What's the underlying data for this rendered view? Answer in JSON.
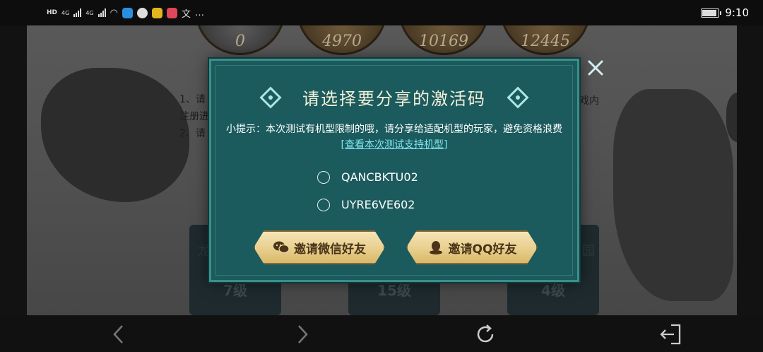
{
  "status_bar": {
    "time": "9:10",
    "network_1": "HD",
    "network_2": "HD",
    "signal_label_1": "4G",
    "signal_label_2": "4G",
    "more": "…",
    "battery_level": 0.9
  },
  "background": {
    "scores": [
      "0",
      "4970",
      "10169",
      "12445"
    ],
    "text_line_1": "1、请",
    "text_line_2": "注册进",
    "text_line_3": "2、请",
    "text_right": "戏内",
    "cards": [
      {
        "name": "龙",
        "level": "7级"
      },
      {
        "name": "",
        "level": "15级"
      },
      {
        "name": "园",
        "level": "4级"
      }
    ]
  },
  "modal": {
    "title": "请选择要分享的激活码",
    "tip_text": "小提示：本次测试有机型限制的哦，请分享给适配机型的玩家，避免资格浪费",
    "tip_link": "[查看本次测试支持机型]",
    "codes": [
      "QANCBKTU02",
      "UYRE6VE602"
    ],
    "wechat_button": "邀请微信好友",
    "qq_button": "邀请QQ好友"
  },
  "colors": {
    "modal_bg": "#1b5a5d",
    "title": "#f2f0d8",
    "link": "#7fe6f0",
    "button_gold": "#e8cf8d"
  },
  "icons": {
    "close": "close-icon",
    "wechat": "wechat-icon",
    "qq": "qq-icon",
    "back": "chevron-left-icon",
    "forward": "chevron-right-icon",
    "refresh": "refresh-icon",
    "exit": "exit-icon"
  }
}
